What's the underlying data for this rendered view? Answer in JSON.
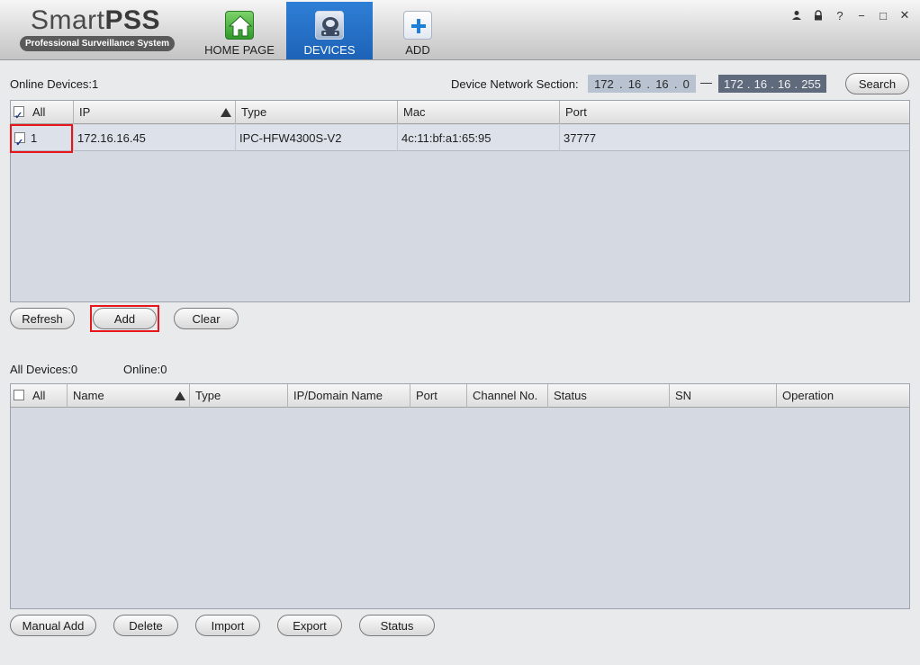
{
  "app": {
    "logo_title_light": "Smart",
    "logo_title_bold": "PSS",
    "logo_subtitle": "Professional Surveillance System"
  },
  "nav": {
    "home_label": "HOME PAGE",
    "devices_label": "DEVICES",
    "add_label": "ADD",
    "active": "DEVICES"
  },
  "window_controls": {
    "user_icon": "user-icon",
    "lock_icon": "lock-icon",
    "help_label": "?",
    "minimize_label": "−",
    "maximize_label": "□",
    "close_label": "✕"
  },
  "online": {
    "title": "Online Devices:1",
    "network_label": "Device Network Section:",
    "ip_start": [
      "172",
      "16",
      "16",
      "0"
    ],
    "ip_end": [
      "172",
      "16",
      "16",
      "255"
    ],
    "ip_sep": "—",
    "search_label": "Search",
    "columns": {
      "all": "All",
      "ip": "IP",
      "type": "Type",
      "mac": "Mac",
      "port": "Port"
    },
    "header_checked": true,
    "rows": [
      {
        "checked": true,
        "index": "1",
        "ip": "172.16.16.45",
        "type": "IPC-HFW4300S-V2",
        "mac": "4c:11:bf:a1:65:95",
        "port": "37777"
      }
    ],
    "buttons": {
      "refresh": "Refresh",
      "add": "Add",
      "clear": "Clear"
    }
  },
  "all_devices": {
    "count_label": "All Devices:0",
    "online_label": "Online:0",
    "columns": {
      "all": "All",
      "name": "Name",
      "type": "Type",
      "ip_domain": "IP/Domain Name",
      "port": "Port",
      "channel": "Channel No.",
      "status": "Status",
      "sn": "SN",
      "operation": "Operation"
    },
    "header_checked": false,
    "buttons": {
      "manual_add": "Manual Add",
      "delete": "Delete",
      "import": "Import",
      "export": "Export",
      "status": "Status"
    }
  },
  "colors": {
    "accent": "#1d63b8",
    "highlight_box": "#e8151a",
    "table_bg": "#d4d9e2"
  }
}
